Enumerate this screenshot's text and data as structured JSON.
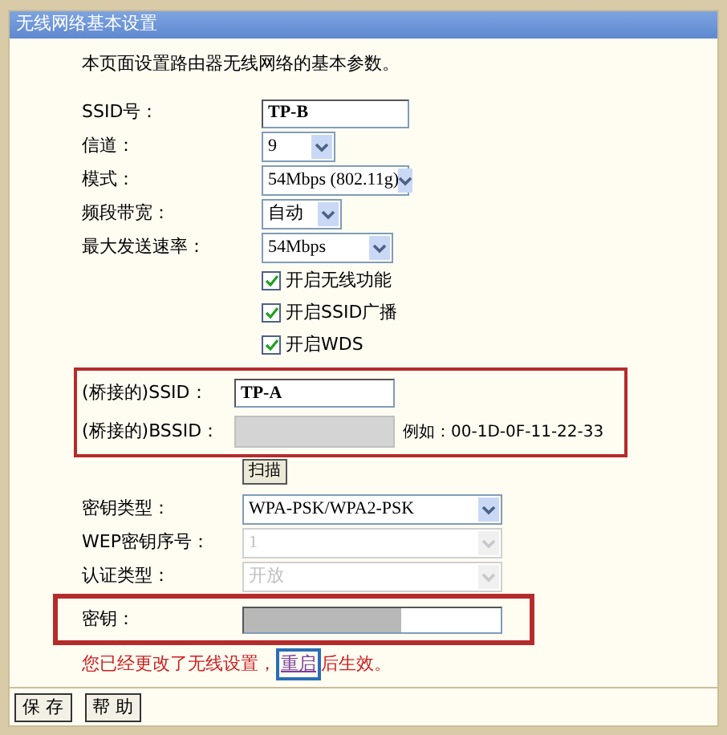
{
  "window": {
    "title": "无线网络基本设置"
  },
  "intro": "本页面设置路由器无线网络的基本参数。",
  "fields": [
    {
      "kind": "text",
      "label": "SSID号：",
      "value": "TP-B"
    },
    {
      "kind": "select",
      "label": "信道：",
      "value": "9"
    },
    {
      "kind": "select",
      "label": "模式：",
      "value": "54Mbps (802.11g)"
    },
    {
      "kind": "select",
      "label": "频段带宽：",
      "value": "自动"
    },
    {
      "kind": "select",
      "label": "最大发送速率：",
      "value": "54Mbps"
    },
    {
      "kind": "checkbox",
      "label": "开启无线功能",
      "checked": true
    },
    {
      "kind": "checkbox",
      "label": "开启SSID广播",
      "checked": true
    },
    {
      "kind": "checkbox",
      "label": "开启WDS",
      "checked": true
    }
  ],
  "bridge": {
    "ssid": {
      "label": "(桥接的)SSID：",
      "value": "TP-A"
    },
    "bssid": {
      "label": "(桥接的)BSSID：",
      "hint": "例如：00-1D-0F-11-22-33"
    },
    "scan_button": "扫描"
  },
  "security": [
    {
      "label": "密钥类型：",
      "value": "WPA-PSK/WPA2-PSK",
      "disabled": false
    },
    {
      "label": "WEP密钥序号：",
      "value": "1",
      "disabled": true
    },
    {
      "label": "认证类型：",
      "value": "开放",
      "disabled": true
    }
  ],
  "key": {
    "label": "密钥："
  },
  "notice": {
    "before": "您已经更改了无线设置，",
    "link": "重启",
    "after": "后生效。"
  },
  "buttons": [
    "保 存",
    "帮 助"
  ]
}
